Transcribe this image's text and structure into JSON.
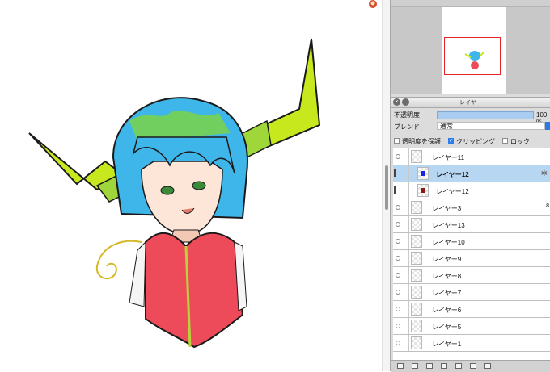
{
  "layer_panel": {
    "title": "レイヤー",
    "opacity_label": "不透明度",
    "opacity_value": "100 %",
    "opacity_fraction": 1.0,
    "blend_label": "ブレンド",
    "blend_value": "通常",
    "protect_alpha_label": "透明度を保護",
    "protect_alpha_checked": false,
    "clipping_label": "クリッピング",
    "clipping_checked": true,
    "lock_label": "ロック",
    "lock_checked": false,
    "layers": [
      {
        "name": "レイヤー11",
        "selected": false,
        "clipped": false
      },
      {
        "name": "レイヤー12",
        "selected": true,
        "clipped": true,
        "swatch": "#1a22e6"
      },
      {
        "name": "レイヤー12",
        "selected": false,
        "clipped": true,
        "swatch": "#8a1a10"
      },
      {
        "name": "レイヤー3",
        "selected": false,
        "clipped": false,
        "badge": "8"
      },
      {
        "name": "レイヤー13",
        "selected": false,
        "clipped": false
      },
      {
        "name": "レイヤー10",
        "selected": false,
        "clipped": false
      },
      {
        "name": "レイヤー9",
        "selected": false,
        "clipped": false
      },
      {
        "name": "レイヤー8",
        "selected": false,
        "clipped": false
      },
      {
        "name": "レイヤー7",
        "selected": false,
        "clipped": false
      },
      {
        "name": "レイヤー6",
        "selected": false,
        "clipped": false
      },
      {
        "name": "レイヤー5",
        "selected": false,
        "clipped": false
      },
      {
        "name": "レイヤー1",
        "selected": false,
        "clipped": false
      }
    ]
  },
  "colors": {
    "hair": "#3fb6ea",
    "hair_highlight": "#7dd63c",
    "horn": "#c8e81e",
    "jacket": "#ee4b5a",
    "selection": "#b7d6f2",
    "nav_frame": "#e0262a"
  },
  "icons": {
    "close": "close-icon",
    "collapse": "collapse-icon",
    "eye": "eye-icon",
    "gear": "gear-icon",
    "new_layer": "new-layer-icon",
    "delete": "trash-icon"
  }
}
